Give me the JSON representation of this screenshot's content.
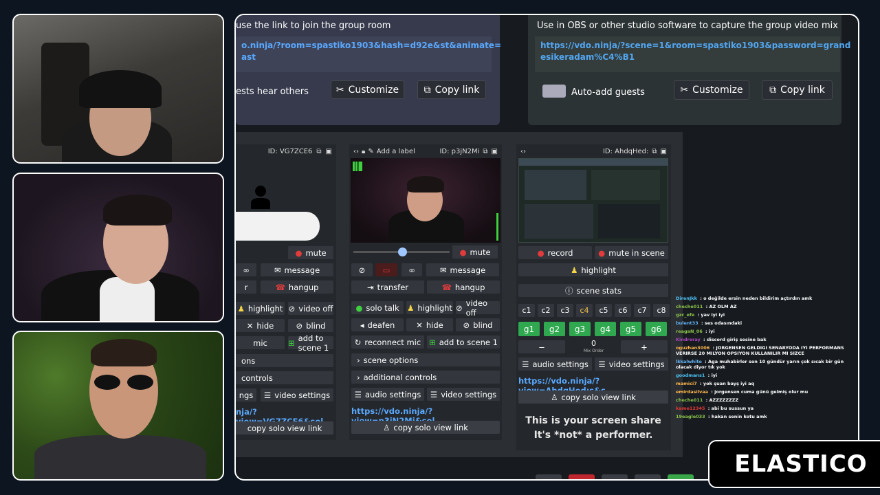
{
  "top": {
    "left_card": {
      "caption": "use the link to join the group room",
      "link": "o.ninja/?room=spastiko1903&hash=d92e&st&animate=\nast",
      "guests_hear": "ests hear others",
      "customize": "Customize",
      "copy": "Copy link"
    },
    "right_card": {
      "caption": "Use in OBS or other studio software to capture the group video mix",
      "link": "https://vdo.ninja/?scene=1&room=spastiko1903&password=grand\nesikeradam%C4%B1",
      "auto_add": "Auto-add guests",
      "customize": "Customize",
      "copy": "Copy link"
    }
  },
  "guests": {
    "g1": {
      "id": "ID: VG7ZCE6",
      "mute": "mute",
      "message": "message",
      "hangup": "hangup",
      "r": "r",
      "highlight": "highlight",
      "video_off": "video off",
      "hide": "hide",
      "blind": "blind",
      "mic": "mic",
      "add_scene": "add to scene 1",
      "ons": "ons",
      "controls": "controls",
      "ngs": "ngs",
      "video_settings": "video settings",
      "link": "nja/?view=VG7ZCE6&sol...",
      "copy_solo": "copy solo view link"
    },
    "g2": {
      "add_label": "Add a label",
      "id": "ID: p3jN2Mi",
      "mute": "mute",
      "message": "message",
      "transfer": "transfer",
      "hangup": "hangup",
      "solo_talk": "solo talk",
      "highlight": "highlight",
      "video_off": "video off",
      "deafen": "deafen",
      "hide": "hide",
      "blind": "blind",
      "reconnect": "reconnect mic",
      "add_scene": "add to scene 1",
      "scene_options": "scene options",
      "additional": "additional controls",
      "audio_settings": "audio settings",
      "video_settings": "video settings",
      "link": "https://vdo.ninja/?view=p3jN2Mi&sol...",
      "copy_solo": "copy solo view link"
    },
    "g3": {
      "id": "ID: AhdqHed:",
      "record": "record",
      "mute_scene": "mute in scene",
      "highlight": "highlight",
      "scene_stats": "scene stats",
      "scenes_c": [
        "c1",
        "c2",
        "c3",
        "c4",
        "c5",
        "c6",
        "c7",
        "c8"
      ],
      "scenes_g": [
        "g1",
        "g2",
        "g3",
        "g4",
        "g5",
        "g6"
      ],
      "minus": "−",
      "plus": "+",
      "mix_value": "0",
      "mix_label": "Mix Order",
      "audio_settings": "audio settings",
      "video_settings": "video settings",
      "link": "https://vdo.ninja/?view=AhdqHed:s&s...",
      "copy_solo": "copy solo view link",
      "screen_share_1": "This is your screen share",
      "screen_share_2": "It's *not* a performer."
    }
  },
  "chat": [
    {
      "user": "DirenJkk",
      "text": "o değilde ersin neden bildirim açtırdın amk",
      "color": "#4fc3f7"
    },
    {
      "user": "cheche011",
      "text": "AZ OLM AZ",
      "color": "#8bc34a"
    },
    {
      "user": "gzc_efe",
      "text": "yav iyi iyi",
      "color": "#8bc34a"
    },
    {
      "user": "bulent33",
      "text": "ses odasındaki",
      "color": "#64b5f6"
    },
    {
      "user": "reagaN_06",
      "text": "iyi",
      "color": "#8bc34a"
    },
    {
      "user": "Kindreray",
      "text": "discord giriş sesine bak",
      "color": "#ab47bc"
    },
    {
      "user": "oguzhan3006",
      "text": "JORGENSEN GELDIGI SENARYODA IYI PERFORMANS VERIRSE 20 MILYON OPSIYON KULLANILIR MI SIZCE",
      "color": "#ffb74d"
    },
    {
      "user": "lkkalwhite",
      "text": "Aga muhabirler son 10 gündür yarın çok sıcak bir gün olacak diyor tık yok",
      "color": "#64b5f6"
    },
    {
      "user": "goodmans1",
      "text": "iyi",
      "color": "#4fc3f7"
    },
    {
      "user": "mamici7",
      "text": "yok şuan bayş iyi aq",
      "color": "#ffb74d"
    },
    {
      "user": "emirdasilvaa",
      "text": "jorgensen cuma günü gelmiş olur mu",
      "color": "#ffb74d"
    },
    {
      "user": "cheche011",
      "text": "AZZZZZZZZ",
      "color": "#8bc34a"
    },
    {
      "user": "kame12345",
      "text": "abi bu sussun ya",
      "color": "#e53935"
    },
    {
      "user": "19eagle033",
      "text": "hakan senin kotu amk",
      "color": "#8bc34a"
    }
  ],
  "logo": "ELASTICO"
}
